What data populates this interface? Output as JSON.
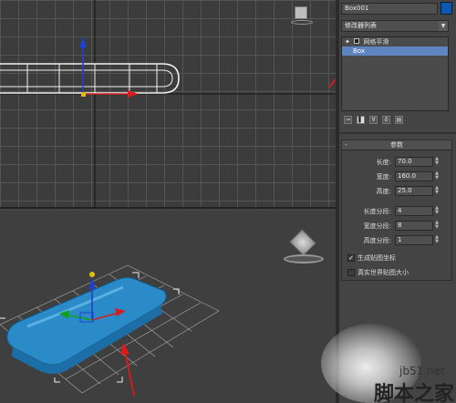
{
  "object": {
    "name": "Box001",
    "color": "#0b57b5"
  },
  "modifier_list": {
    "value": "修改器列表",
    "arrow_icon": "chevron-down-icon"
  },
  "stack": {
    "items": [
      {
        "label": "网格平滑",
        "selected": false
      },
      {
        "label": "Box",
        "selected": true
      }
    ]
  },
  "stack_tools": [
    "pin-stack-icon",
    "show-end-result-icon",
    "make-unique-icon",
    "remove-modifier-icon",
    "configure-sets-icon"
  ],
  "params": {
    "title": "参数",
    "collapse_symbol": "-",
    "length_label": "长度:",
    "length_value": "70.0",
    "width_label": "宽度:",
    "width_value": "160.0",
    "height_label": "高度:",
    "height_value": "25.0",
    "length_segs_label": "长度分段:",
    "length_segs_value": "4",
    "width_segs_label": "宽度分段:",
    "width_segs_value": "8",
    "height_segs_label": "高度分段:",
    "height_segs_value": "1",
    "gen_map_coords_label": "生成贴图坐标",
    "gen_map_coords_checked": true,
    "real_world_map_label": "真实世界贴图大小",
    "real_world_map_checked": false
  },
  "watermark": {
    "site": "jb51.net",
    "name": "脚本之家"
  }
}
